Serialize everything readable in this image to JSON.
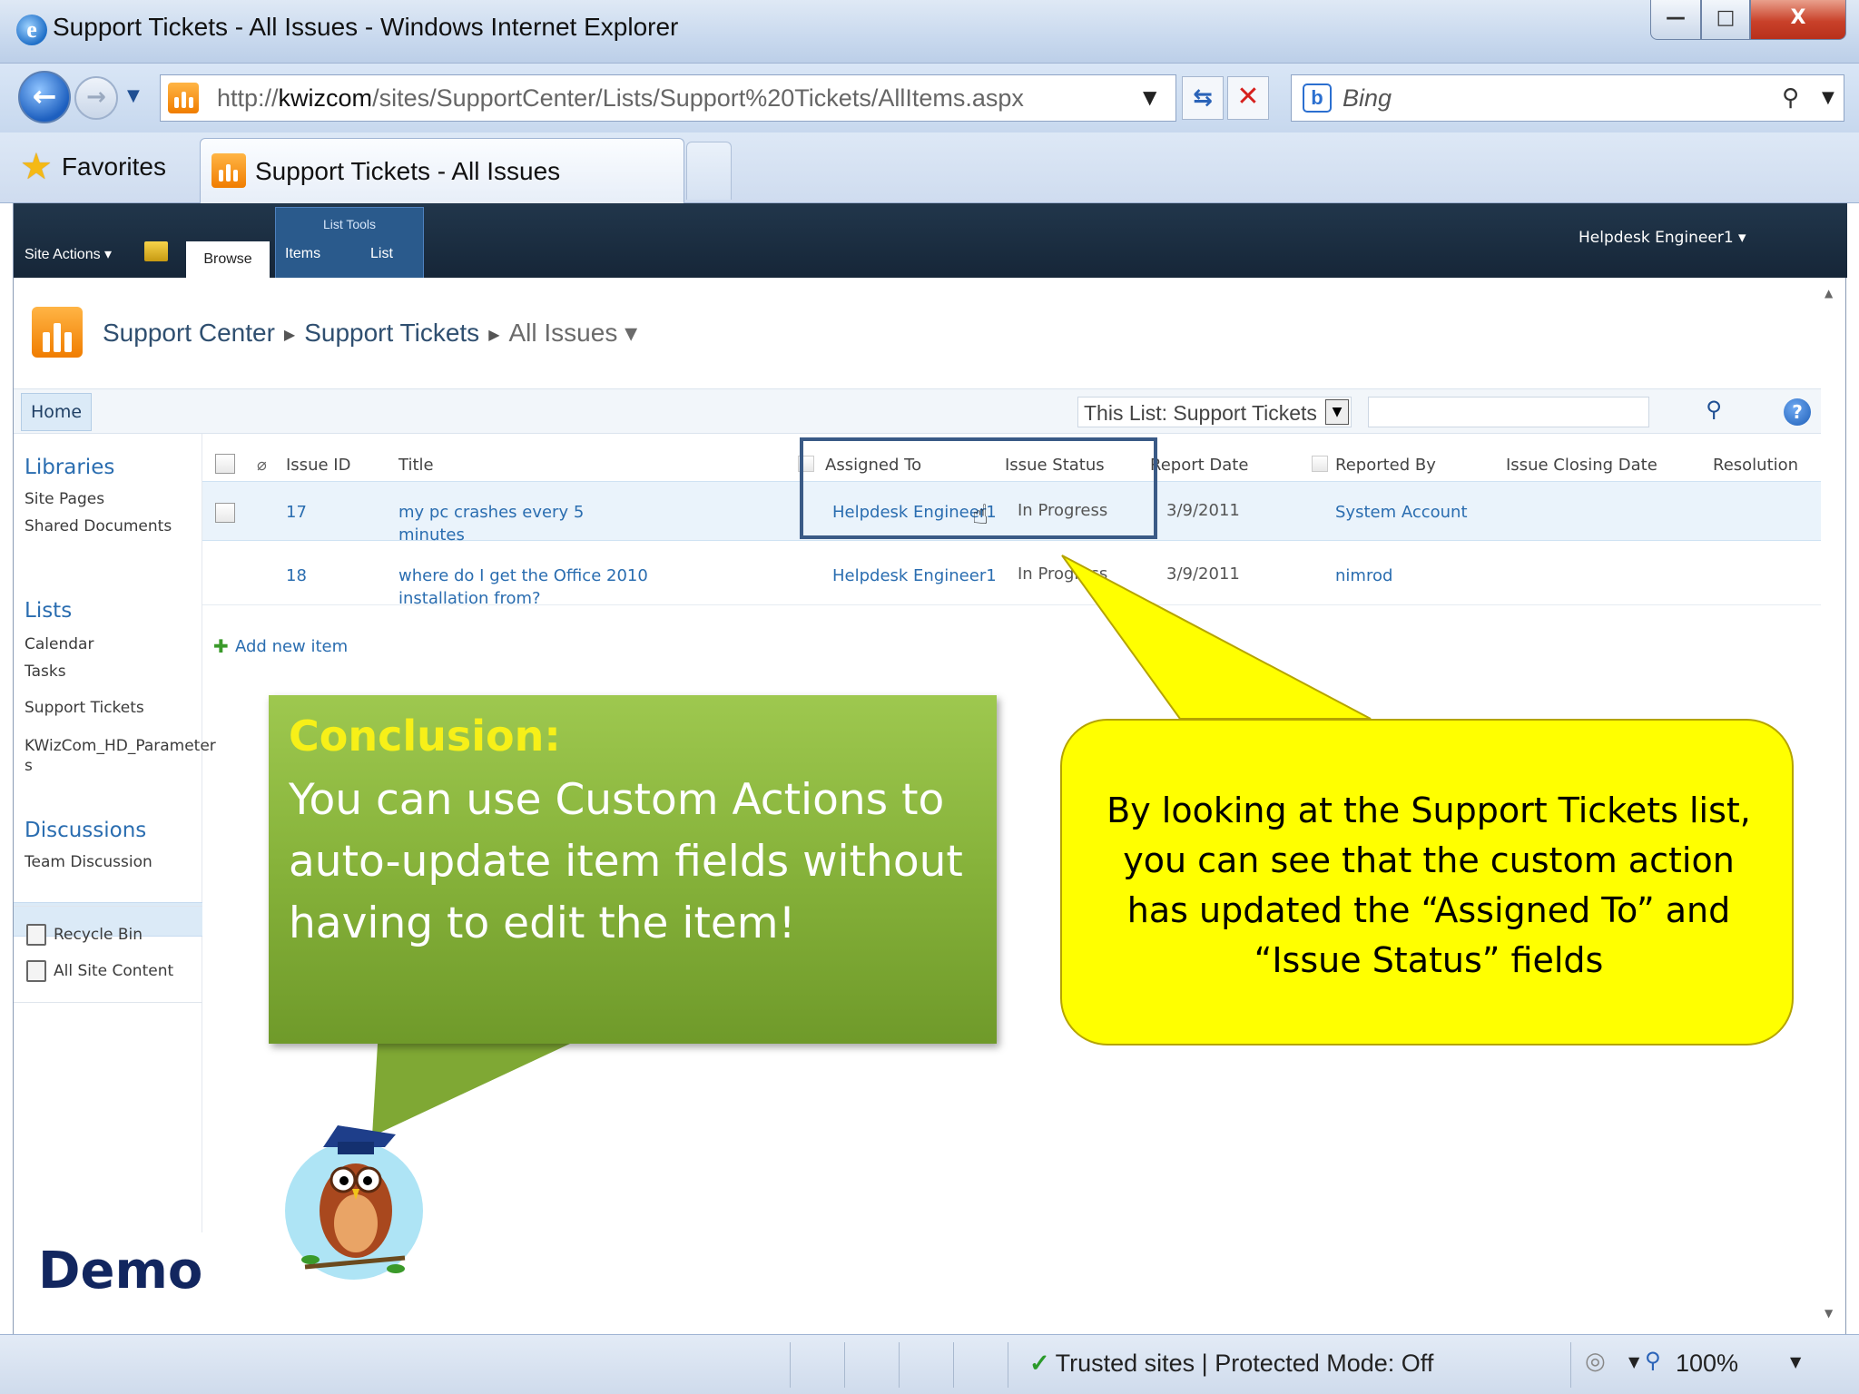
{
  "window": {
    "title": "Support Tickets - All Issues - Windows Internet Explorer",
    "minimize": "—",
    "maximize": "□",
    "close": "X"
  },
  "nav": {
    "back": "←",
    "forward": "→",
    "address_prefix": "http://",
    "address_host": "kwizcom",
    "address_path": "/sites/SupportCenter/Lists/Support%20Tickets/AllItems.aspx",
    "search_placeholder": "Bing"
  },
  "tabs": {
    "favorites_label": "Favorites",
    "active_tab_title": "Support Tickets - All Issues"
  },
  "ribbon": {
    "site_actions": "Site Actions ▾",
    "browse_tab": "Browse",
    "list_tools": "List Tools",
    "items_tab": "Items",
    "list_tab": "List",
    "user_menu": "Helpdesk Engineer1 ▾"
  },
  "breadcrumb": {
    "site": "Support Center",
    "list": "Support Tickets",
    "view": "All Issues ▾"
  },
  "toplinkbar": {
    "home": "Home",
    "search_scope": "This List: Support Tickets",
    "help": "?"
  },
  "quicklaunch": {
    "libraries_heading": "Libraries",
    "libraries": [
      "Site Pages",
      "Shared Documents"
    ],
    "lists_heading": "Lists",
    "lists": [
      "Calendar",
      "Tasks",
      "Support Tickets",
      "KWizCom_HD_Parameter",
      "s"
    ],
    "discussions_heading": "Discussions",
    "discussions": [
      "Team Discussion"
    ],
    "recycle_bin": "Recycle Bin",
    "all_site_content": "All Site Content"
  },
  "listview": {
    "columns": [
      "Issue ID",
      "Title",
      "Assigned To",
      "Issue Status",
      "Report Date",
      "Reported By",
      "Issue Closing Date",
      "Resolution"
    ],
    "rows": [
      {
        "issue_id": "17",
        "title_line1": "my pc crashes every 5",
        "title_line2": "minutes",
        "assigned_to": "Helpdesk Engineer1",
        "issue_status": "In Progress",
        "report_date": "3/9/2011",
        "reported_by": "System Account"
      },
      {
        "issue_id": "18",
        "title_line1": "where do I get the Office 2010",
        "title_line2": "installation from?",
        "assigned_to": "Helpdesk Engineer1",
        "issue_status": "In Progress",
        "report_date": "3/9/2011",
        "reported_by": "nimrod"
      }
    ],
    "add_new_item": "Add new item"
  },
  "statusbar": {
    "trusted": "Trusted sites | Protected Mode: Off",
    "zoom": "100%"
  },
  "overlay": {
    "conclusion_title": "Conclusion:",
    "conclusion_body": "You can use Custom Actions to auto-update item fields without having to edit the item!",
    "callout": "By looking at the Support Tickets list, you can see that the custom action has updated the “Assigned To” and “Issue Status” fields",
    "demo_label": "Demo"
  }
}
